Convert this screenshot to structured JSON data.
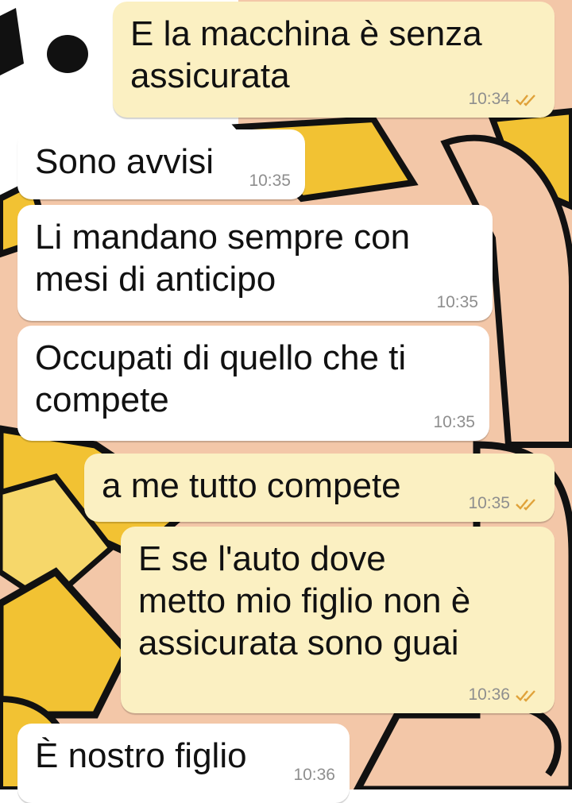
{
  "colors": {
    "incoming_bubble": "#ffffff",
    "outgoing_bubble": "#fbf0c2",
    "timestamp": "#8e8e8e",
    "read_ticks": "#e0a23a",
    "wallpaper_skin": "#f3c7a8",
    "wallpaper_yellow": "#f2c233",
    "wallpaper_outline": "#111111"
  },
  "messages": [
    {
      "direction": "out",
      "text": "E la macchina è senza\nassicurata",
      "time": "10:34",
      "status_icon": "double-check-icon"
    },
    {
      "direction": "in",
      "text": "Sono avvisi",
      "time": "10:35"
    },
    {
      "direction": "in",
      "text": "Li mandano sempre con\nmesi di anticipo",
      "time": "10:35"
    },
    {
      "direction": "in",
      "text": "Occupati di quello che ti\ncompete",
      "time": "10:35"
    },
    {
      "direction": "out",
      "text": "a me tutto compete",
      "time": "10:35",
      "status_icon": "double-check-icon"
    },
    {
      "direction": "out",
      "text": "E se l'auto dove\nmetto mio figlio non è\nassicurata sono guai",
      "time": "10:36",
      "status_icon": "double-check-icon"
    },
    {
      "direction": "in",
      "text": "È nostro figlio",
      "time": "10:36"
    }
  ]
}
